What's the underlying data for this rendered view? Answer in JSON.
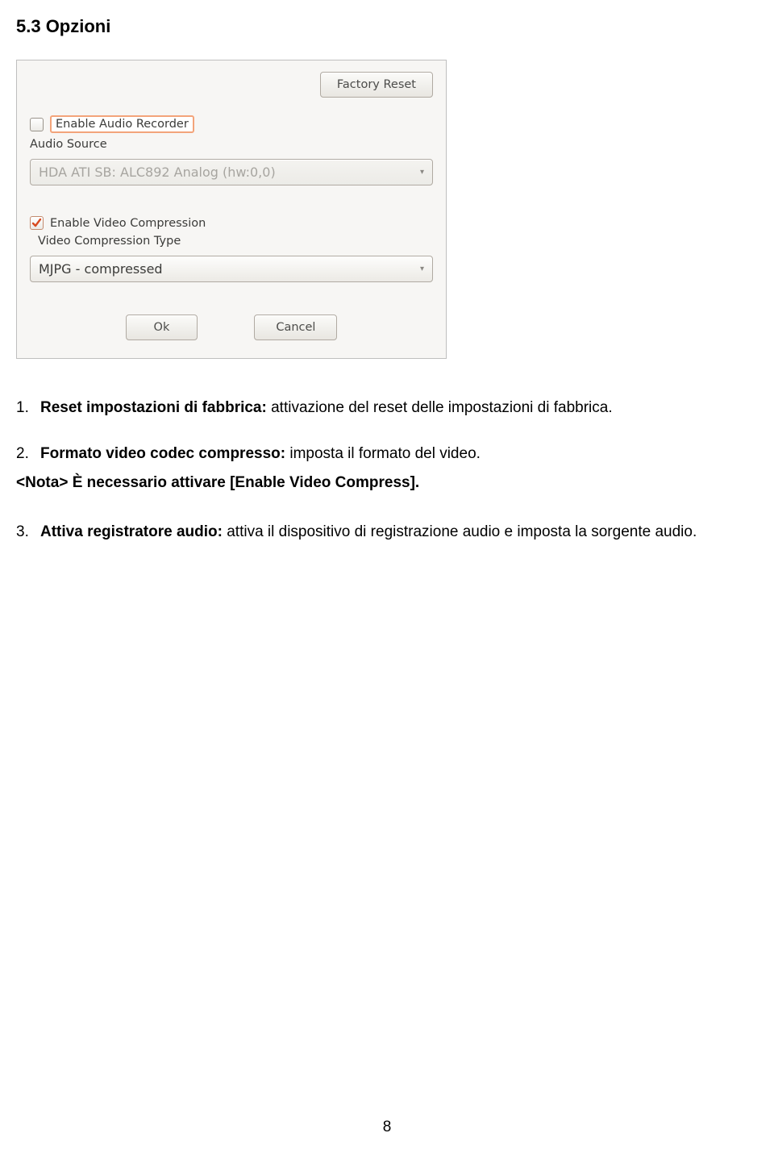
{
  "heading": "5.3 Opzioni",
  "screenshot": {
    "factory_reset": "Factory Reset",
    "enable_audio_recorder": "Enable Audio Recorder",
    "audio_source_label": "Audio Source",
    "audio_source_value": "HDA ATI SB: ALC892 Analog (hw:0,0)",
    "enable_video_compression": "Enable Video Compression",
    "video_compression_type_label": "Video Compression Type",
    "video_compression_value": "MJPG - compressed",
    "ok": "Ok",
    "cancel": "Cancel"
  },
  "items": {
    "n1_num": "1.",
    "n1_bold": "Reset impostazioni di fabbrica: ",
    "n1_rest": "attivazione del reset delle impostazioni di fabbrica.",
    "n2_num": "2.",
    "n2_bold": "Formato video codec compresso: ",
    "n2_rest": "imposta il formato del video.",
    "note": "<Nota> È necessario attivare [Enable Video Compress].",
    "n3_num": "3.",
    "n3_bold": "Attiva registratore audio: ",
    "n3_rest": "attiva il dispositivo di registrazione audio e imposta la sorgente audio."
  },
  "page_number": "8"
}
